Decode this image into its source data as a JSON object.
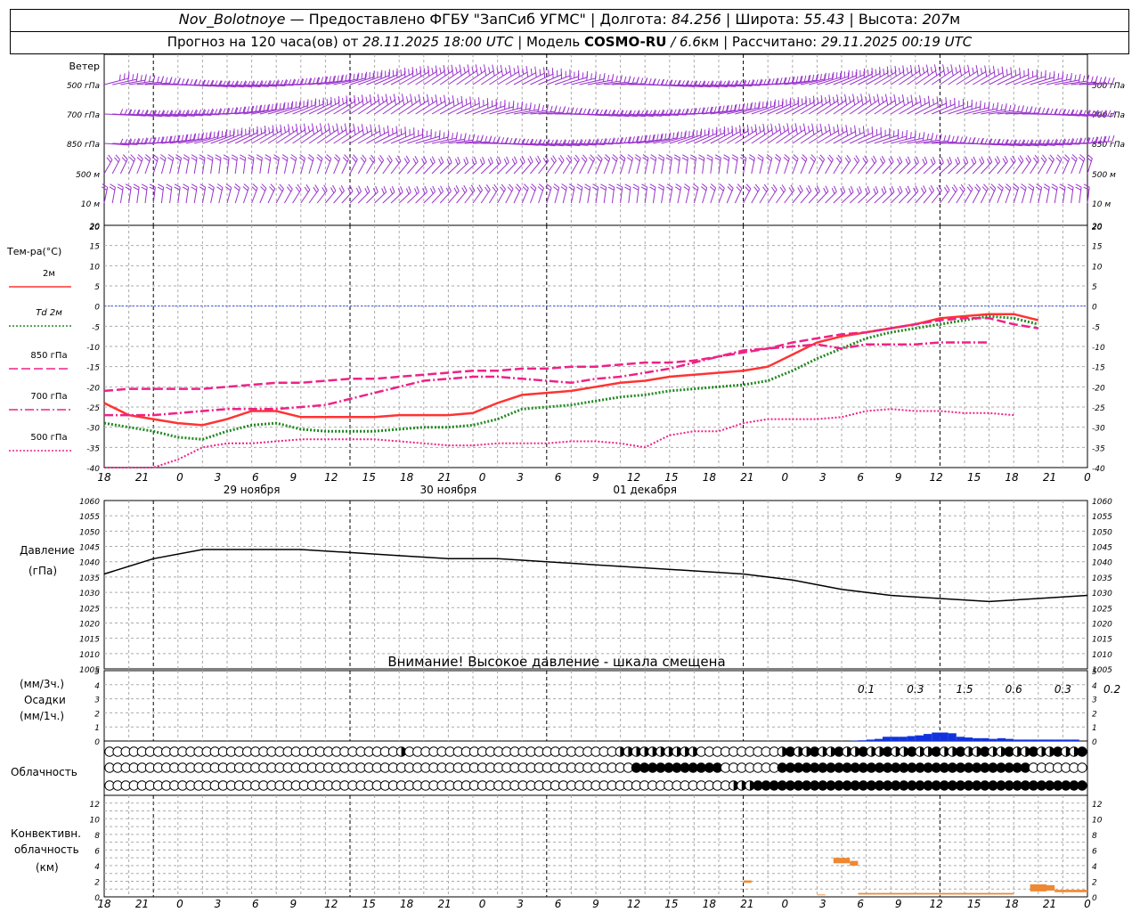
{
  "header": {
    "line1": {
      "station": "Nov_Bolotnoye",
      "provider": "— Предоставлено ФГБУ \"ЗапСиб УГМС\"",
      "lon_label": "| Долгота:",
      "lon_value": "84.256",
      "lat_label": "| Широта:",
      "lat_value": "55.43",
      "alt_label": "| Высота:",
      "alt_value": "207",
      "alt_unit": "м"
    },
    "line2": {
      "forecast_label": "Прогноз на 120 часа(ов) от",
      "forecast_start": "28.11.2025 18:00 UTC",
      "model_label": "| Модель",
      "model_name": "COSMO-RU",
      "model_res": "/ 6.6",
      "model_res_unit": "км",
      "calc_label": "| Рассчитано:",
      "calc_time": "29.11.2025 00:19 UTC"
    }
  },
  "time_axis": {
    "hour_labels": [
      "18",
      "21",
      "0",
      "3",
      "6",
      "9",
      "12",
      "15",
      "18",
      "21",
      "0",
      "3",
      "6",
      "9",
      "12",
      "15",
      "18",
      "21",
      "0",
      "3",
      "6",
      "9",
      "12",
      "15",
      "18",
      "21",
      "0"
    ],
    "dates": [
      "29 ноября",
      "30 ноября",
      "01 декабря"
    ]
  },
  "wind_panel": {
    "title": "Ветер",
    "levels": [
      {
        "label": "500 гПа"
      },
      {
        "label": "700 гПа"
      },
      {
        "label": "850 гПа"
      },
      {
        "label": "500 м"
      },
      {
        "label": "10  м"
      }
    ],
    "barb_color": "#9933cc"
  },
  "temp_panel": {
    "title": "Тем-ра(°C)",
    "ticks": [
      "20",
      "15",
      "10",
      "5",
      "0",
      "-5",
      "-10",
      "-15",
      "-20",
      "-25",
      "-30",
      "-35",
      "-40"
    ],
    "legend": [
      {
        "label": "2м",
        "color": "#ff3333",
        "style": "solid"
      },
      {
        "label": "Td 2м",
        "color": "#228822",
        "style": "dotted"
      },
      {
        "label": "850 гПа",
        "color": "#ee2288",
        "style": "dash"
      },
      {
        "label": "700 гПа",
        "color": "#ee2288",
        "style": "dashdot"
      },
      {
        "label": "500 гПа",
        "color": "#ee2288",
        "style": "dotted"
      }
    ]
  },
  "pressure_panel": {
    "title": "Давление",
    "unit": "(гПа)",
    "ticks": [
      "1060",
      "1055",
      "1050",
      "1045",
      "1040",
      "1035",
      "1030",
      "1025",
      "1020",
      "1015",
      "1010",
      "1005"
    ],
    "warning": "Внимание! Высокое давление - шкала смещена"
  },
  "precip_panel": {
    "label_3h": "(мм/3ч.)",
    "title": "Осадки",
    "label_1h": "(мм/1ч.)",
    "ticks": [
      "5",
      "4",
      "3",
      "2",
      "1",
      "0"
    ],
    "totals_3h": [
      "0.1",
      "0.3",
      "1.5",
      "0.6",
      "0.3",
      "0.2"
    ]
  },
  "cloud_panel": {
    "title": "Облачность"
  },
  "conv_panel": {
    "title_line1": "Конвективн.",
    "title_line2": "облачность",
    "title_line3": "(км)",
    "ticks": [
      "12",
      "10",
      "8",
      "6",
      "4",
      "2",
      "0"
    ]
  },
  "colors": {
    "temp_2m": "#ff3333",
    "dewpoint": "#228822",
    "upper_air": "#ee2288",
    "pressure": "#000000",
    "precip": "#1133dd",
    "convective": "#ee8833",
    "grid": "#aaaaaa"
  },
  "chart_data": [
    {
      "type": "line",
      "title": "Тем-ра(°C)",
      "x_hours": [
        0,
        3,
        6,
        9,
        12,
        15,
        18,
        21,
        24,
        27,
        30,
        33,
        36,
        39,
        42,
        45,
        48,
        51,
        54,
        57,
        60,
        63,
        66,
        69,
        72,
        75,
        78,
        81,
        84,
        87,
        90,
        93,
        96,
        99,
        102,
        105,
        108,
        111,
        114,
        117,
        120
      ],
      "ylim": [
        -40,
        20
      ],
      "series": [
        {
          "name": "2м",
          "values": [
            -24,
            -27,
            -28,
            -29,
            -29.5,
            -28,
            -26,
            -26,
            -27.5,
            -27.5,
            -27.5,
            -27.5,
            -27,
            -27,
            -27,
            -26.5,
            -24,
            -22,
            -21.5,
            -21,
            -20,
            -19,
            -18.5,
            -17.5,
            -17,
            -16.5,
            -16,
            -15,
            -12,
            -9,
            -7.5,
            -6.5,
            -5.5,
            -4.5,
            -3,
            -2.5,
            -2,
            -2,
            -3.5
          ]
        },
        {
          "name": "Td 2м",
          "values": [
            -29,
            -30,
            -31,
            -32.5,
            -33,
            -31,
            -29.5,
            -29,
            -30.5,
            -31,
            -31,
            -31,
            -30.5,
            -30,
            -30,
            -29.5,
            -28,
            -25.5,
            -25,
            -24.5,
            -23.5,
            -22.5,
            -22,
            -21,
            -20.5,
            -20,
            -19.5,
            -18.5,
            -16,
            -13,
            -10.5,
            -8,
            -6.5,
            -5.5,
            -4.5,
            -3.5,
            -2.5,
            -3,
            -4.5
          ]
        },
        {
          "name": "850 гПа",
          "values": [
            -21,
            -20.5,
            -20.5,
            -20.5,
            -20.5,
            -20,
            -19.5,
            -19,
            -19,
            -18.5,
            -18,
            -18,
            -17.5,
            -17,
            -16.5,
            -16,
            -16,
            -15.5,
            -15.5,
            -15,
            -15,
            -14.5,
            -14,
            -14,
            -13.5,
            -12.5,
            -11.5,
            -10.5,
            -9,
            -8,
            -7,
            -6.5,
            -5.5,
            -4.5,
            -3.5,
            -3,
            -3,
            -4.5,
            -5.5
          ]
        },
        {
          "name": "700 гПа",
          "values": [
            -27,
            -27,
            -27,
            -26.5,
            -26,
            -25.5,
            -25.5,
            -25.5,
            -25,
            -24.5,
            -23,
            -21.5,
            -20,
            -18.5,
            -18,
            -17.5,
            -17.5,
            -18,
            -18.5,
            -19,
            -18,
            -17.5,
            -16.5,
            -15.5,
            -14,
            -12.5,
            -11,
            -10.5,
            -10,
            -9.5,
            -10.5,
            -9.5,
            -9.5,
            -9.5,
            -9,
            -9,
            -9
          ]
        },
        {
          "name": "500 гПа",
          "values": [
            -45,
            -42,
            -40,
            -38,
            -35,
            -34,
            -34,
            -33.5,
            -33,
            -33,
            -33,
            -33,
            -33.5,
            -34,
            -34.5,
            -34.5,
            -34,
            -34,
            -34,
            -33.5,
            -33.5,
            -34,
            -35,
            -32,
            -31,
            -31,
            -29,
            -28,
            -28,
            -28,
            -27.5,
            -26,
            -25.5,
            -26,
            -26,
            -26.5,
            -26.5,
            -27
          ]
        }
      ]
    },
    {
      "type": "line",
      "title": "Давление",
      "ylabel": "(гПа)",
      "ylim": [
        1005,
        1060
      ],
      "x_hours": [
        0,
        6,
        12,
        18,
        24,
        30,
        36,
        42,
        48,
        54,
        60,
        66,
        72,
        78,
        84,
        90,
        96,
        102,
        108,
        114,
        120
      ],
      "series": [
        {
          "name": "Давление",
          "values": [
            1036,
            1041,
            1044,
            1044,
            1044,
            1043,
            1042,
            1041,
            1041,
            1040,
            1039,
            1038,
            1037,
            1036,
            1034,
            1031,
            1029,
            1028,
            1027,
            1028,
            1029
          ]
        }
      ]
    },
    {
      "type": "bar",
      "title": "Осадки",
      "ylabel": "(мм/1ч.)",
      "ylim": [
        0,
        5
      ],
      "x_hours": [
        92,
        93,
        94,
        95,
        96,
        97,
        98,
        99,
        100,
        101,
        102,
        103,
        104,
        105,
        106,
        107,
        108,
        109,
        110,
        111,
        112,
        113,
        114,
        115,
        116,
        117,
        118,
        119
      ],
      "values": [
        0.02,
        0.05,
        0.1,
        0.15,
        0.3,
        0.3,
        0.3,
        0.35,
        0.4,
        0.5,
        0.6,
        0.6,
        0.55,
        0.3,
        0.25,
        0.2,
        0.2,
        0.15,
        0.2,
        0.15,
        0.1,
        0.1,
        0.1,
        0.1,
        0.1,
        0.1,
        0.1,
        0.1
      ]
    },
    {
      "type": "bar",
      "title": "Конвективн. облачность",
      "ylabel": "(км)",
      "ylim": [
        0,
        13
      ],
      "bars": [
        {
          "x_from": 78,
          "x_to": 79,
          "bottom": 1.8,
          "top": 2.1
        },
        {
          "x_from": 87,
          "x_to": 88,
          "bottom": 0.2,
          "top": 0.3
        },
        {
          "x_from": 89,
          "x_to": 91,
          "bottom": 4.3,
          "top": 5.0
        },
        {
          "x_from": 91,
          "x_to": 92,
          "bottom": 4.0,
          "top": 4.6
        },
        {
          "x_from": 92,
          "x_to": 111,
          "bottom": 0.3,
          "top": 0.5
        },
        {
          "x_from": 113,
          "x_to": 115,
          "bottom": 0.7,
          "top": 1.6
        },
        {
          "x_from": 115,
          "x_to": 116,
          "bottom": 0.8,
          "top": 1.5
        },
        {
          "x_from": 116,
          "x_to": 120,
          "bottom": 0.6,
          "top": 0.9
        }
      ]
    }
  ]
}
